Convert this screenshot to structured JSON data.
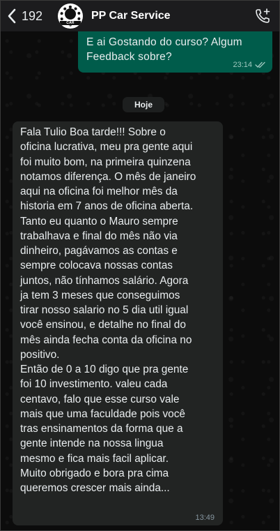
{
  "header": {
    "back_count": "192",
    "chat_name": "PP Car Service",
    "avatar_text": "CAR SERVICE"
  },
  "messages": {
    "outgoing": {
      "text": "E ai Gostando do curso? Algum Feedback sobre?",
      "time": "23:14"
    },
    "date_divider": "Hoje",
    "incoming": {
      "text": "Fala Tulio Boa tarde!!! Sobre o\noficina lucrativa, meu pra gente aqui\nfoi muito bom,  na primeira quinzena\nnotamos diferença. O mês de janeiro\naqui na oficina foi melhor mês da\nhistoria em 7 anos de oficina aberta.\nTanto eu quanto o Mauro sempre\ntrabalhava e final do mês não via\ndinheiro, pagávamos as contas e\nsempre colocava nossas contas\njuntos, não tínhamos salário. Agora\nja tem 3 meses que conseguimos\ntirar nosso salario no 5 dia util igual\nvocê ensinou, e detalhe no final do\nmês ainda fecha conta da oficina no\npositivo.\nEntão de 0 a 10 digo que pra gente\nfoi 10 investimento. valeu cada\ncentavo, falo que esse curso vale\nmais que uma faculdade pois você\ntras ensinamentos da forma que a\ngente intende na nossa lingua\nmesmo e fica mais facil aplicar.\nMuito obrigado e bora pra cima\nqueremos crescer mais ainda...",
      "time": "13:49"
    }
  },
  "icons": {
    "back": "chevron-left-icon",
    "call": "phone-add-icon",
    "read_status": "double-check-icon"
  },
  "colors": {
    "outgoing_bubble": "#005c4b",
    "incoming_bubble": "#222423",
    "header_bg": "#1c1c1e"
  }
}
